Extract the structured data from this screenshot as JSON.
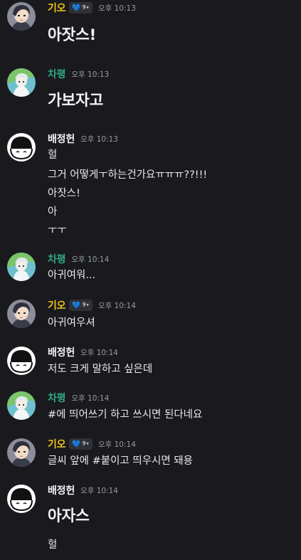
{
  "colors": {
    "background": "#1a1a1e",
    "kio_name": "#f0c419",
    "chapyeong_name": "#2fa882",
    "baejungheon_name": "#f2f3f5",
    "timestamp": "#949ba4"
  },
  "users": {
    "kio": {
      "name": "기오",
      "badge_icons": [
        "heart-icon",
        "sparkle-icon"
      ]
    },
    "chapyeong": {
      "name": "차평"
    },
    "baejungheon": {
      "name": "배정헌"
    }
  },
  "messages": [
    {
      "author": "기오",
      "time": "오후 10:13",
      "lines": [
        "아잣스!"
      ],
      "large": true
    },
    {
      "author": "차평",
      "time": "오후 10:13",
      "lines": [
        "가보자고"
      ],
      "large": true
    },
    {
      "author": "배정헌",
      "time": "오후 10:13",
      "lines": [
        "헐",
        "그거 어떻게ㅜ하는건가요ㅠㅠㅠ??!!!",
        "아잣스!",
        "아",
        "ㅜㅜ"
      ]
    },
    {
      "author": "차평",
      "time": "오후 10:14",
      "lines": [
        "아귀여워..."
      ]
    },
    {
      "author": "기오",
      "time": "오후 10:14",
      "lines": [
        "아귀여우셔"
      ]
    },
    {
      "author": "배정헌",
      "time": "오후 10:14",
      "lines": [
        "저도 크게 말하고 싶은데"
      ]
    },
    {
      "author": "차평",
      "time": "오후 10:14",
      "lines": [
        "#에 띄어쓰기 하고 쓰시면 된다네요"
      ]
    },
    {
      "author": "기오",
      "time": "오후 10:14",
      "lines": [
        "글씨 앞에 #붙이고 띄우시면 돼용"
      ]
    },
    {
      "author": "배정헌",
      "time": "오후 10:14",
      "lines": [
        "아자스",
        "헐"
      ],
      "large_first": true
    }
  ]
}
